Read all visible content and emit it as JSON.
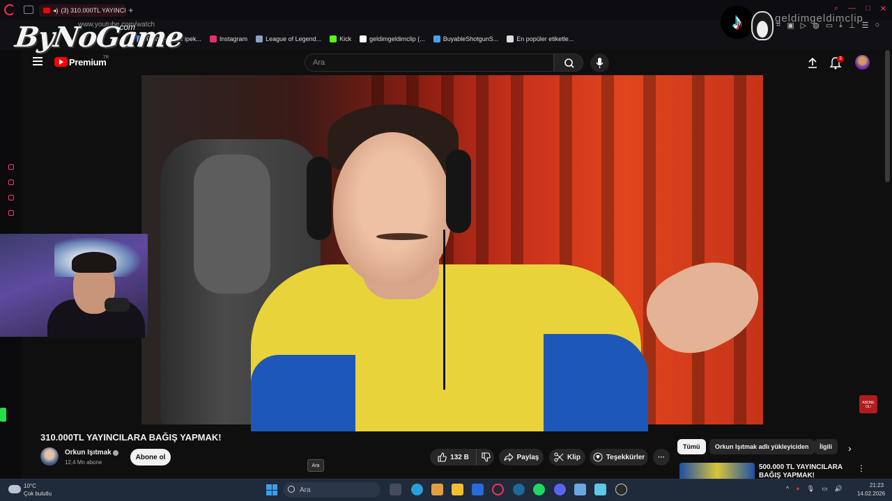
{
  "browser": {
    "tab_title": "(3) 310.000TL YAYINCI",
    "new_tab": "+",
    "url": "www.youtube.com/watch",
    "window_controls": [
      "⌕",
      "—",
      "□",
      "✕"
    ],
    "bookmarks": [
      {
        "label": "Posta - yusuf ipek...",
        "icon": "mail-icon",
        "color": "#4a8ef0"
      },
      {
        "label": "Instagram",
        "icon": "instagram-icon",
        "color": "#e1306c"
      },
      {
        "label": "League of Legend...",
        "icon": "lol-icon",
        "color": "#8aa0c8"
      },
      {
        "label": "Kick",
        "icon": "kick-icon",
        "color": "#53fc18"
      },
      {
        "label": "geldimgeldimclip (...",
        "icon": "tiktok-icon",
        "color": "#ffffff"
      },
      {
        "label": "BuyableShotgunS...",
        "icon": "twitch-clip-icon",
        "color": "#4aa0f0"
      },
      {
        "label": "En popüler etiketle...",
        "icon": "page-icon",
        "color": "#dddddd"
      }
    ]
  },
  "overlay": {
    "logo_text": "ByNoGame",
    "logo_sub": ".com",
    "tiktok_handle": "geldimgeldimclip"
  },
  "youtube": {
    "brand": "Premium",
    "brand_region": "TR",
    "search_placeholder": "Ara",
    "notification_count": "3"
  },
  "video": {
    "title": "310.000TL YAYINCILARA BAĞIŞ YAPMAK!",
    "channel": "Orkun Işıtmak",
    "subscribers": "12,4 Mn abone",
    "subscribe_label": "Abone ol",
    "likes": "132 B",
    "share_label": "Paylaş",
    "clip_label": "Klip",
    "thanks_label": "Teşekkürler",
    "more_label": "···",
    "badge_text": "ABONE OL!",
    "badge_arrows": "↓↓↓"
  },
  "sidebar_right": {
    "chips": [
      "Tümü",
      "Orkun Işıtmak adlı yükleyiciden",
      "İlgili"
    ],
    "next_label": "›",
    "recommendation_title": "500.000 TL YAYINCILARA BAĞIŞ YAPMAK!",
    "more_label": "⋮"
  },
  "taskbar": {
    "temperature": "10°C",
    "weather": "Çok bulutlu",
    "search_placeholder": "Ara",
    "tooltip": "Ara",
    "time": "21:23",
    "date": "14.02.2026",
    "tray_icons": [
      "^",
      "●",
      "🎙",
      "▭",
      "🔊"
    ],
    "apps": [
      {
        "name": "task-view-icon",
        "color": "#444c5c"
      },
      {
        "name": "edge-icon",
        "color": "#2aa0d8"
      },
      {
        "name": "copilot-icon",
        "color": "#e0a040"
      },
      {
        "name": "file-explorer-icon",
        "color": "#f0c030"
      },
      {
        "name": "store-icon",
        "color": "#2a6ad8"
      },
      {
        "name": "opera-gx-icon",
        "color": "#ff2d55"
      },
      {
        "name": "steam-icon",
        "color": "#1b6a9a"
      },
      {
        "name": "spotify-icon",
        "color": "#1ed760"
      },
      {
        "name": "discord-icon",
        "color": "#5865f2"
      },
      {
        "name": "network-app-icon",
        "color": "#6aa8e0"
      },
      {
        "name": "notepad-icon",
        "color": "#5ec8e8"
      },
      {
        "name": "obs-icon",
        "color": "#2a2a2a"
      }
    ]
  }
}
